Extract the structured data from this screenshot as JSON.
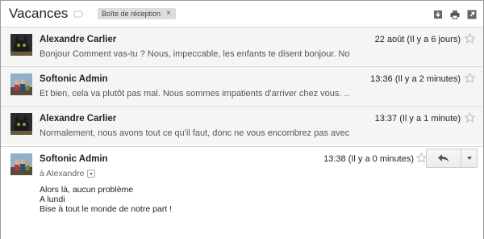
{
  "thread": {
    "subject": "Vacances",
    "label": "Boîte de réception",
    "label_remove": "×"
  },
  "messages": [
    {
      "sender": "Alexandre Carlier",
      "date": "22 août (Il y a 6 jours)",
      "snippet": "Bonjour Comment vas-tu ? Nous, impeccable, les enfants te disent bonjour. Nou...",
      "avatar": "cat-avatar"
    },
    {
      "sender": "Softonic Admin",
      "date": "13:36 (Il y a 2 minutes)",
      "snippet": "Et bien, cela va plutôt pas mal. Nous sommes impatients d'arriver chez vous. ...",
      "avatar": "people-avatar"
    },
    {
      "sender": "Alexandre Carlier",
      "date": "13:37 (Il y a 1 minute)",
      "snippet": "Normalement, nous avons tout ce qu'il faut, donc ne vous encombrez pas avec d...",
      "avatar": "cat-avatar"
    }
  ],
  "expanded": {
    "sender": "Softonic Admin",
    "date": "13:38 (Il y a 0 minutes)",
    "to": "à Alexandre",
    "body": [
      "Alors là, aucun problème",
      "A lundi",
      "Bise à tout le monde de notre part !"
    ]
  },
  "colors": {
    "row_bg": "#f5f5f5",
    "chip_bg": "#dddddd",
    "border": "#d8d8d8"
  }
}
